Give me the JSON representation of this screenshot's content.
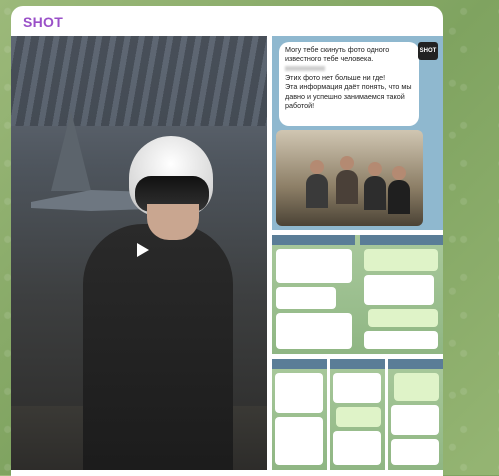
{
  "channel": {
    "name": "SHOT",
    "name_color": "#9a50c8"
  },
  "media": {
    "video": {
      "play_icon": "play-icon"
    },
    "photo_top_right": {
      "bubble_text_1": "Могу тебе скинуть фото одного известного тебе человека.",
      "bubble_text_2": "Этих фото нет больше ни где!",
      "bubble_text_3": "Эта информация даёт понять, что мы давно и успешно занимаемся такой работой!",
      "logo_text": "SHOT"
    }
  }
}
